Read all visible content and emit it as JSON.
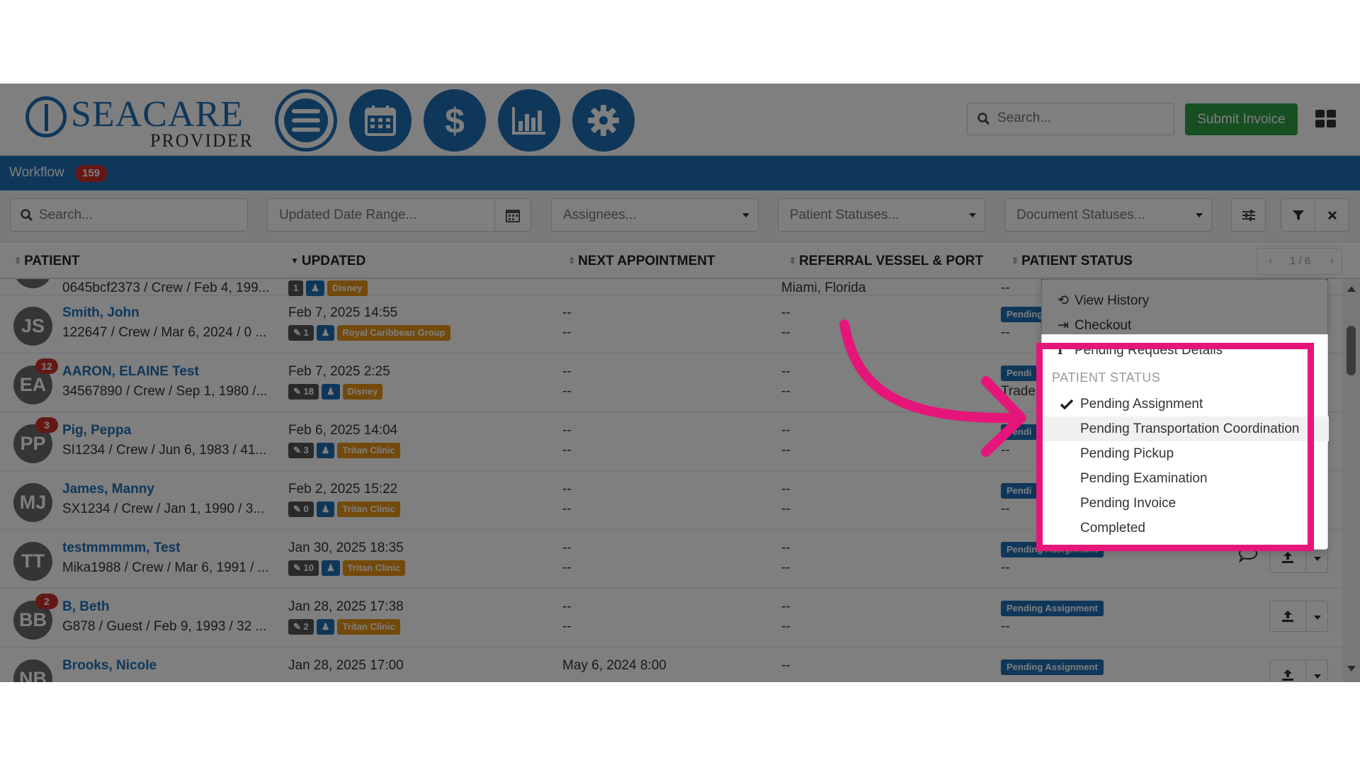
{
  "brand": {
    "name": "SEACARE",
    "sub": "PROVIDER"
  },
  "top": {
    "search_placeholder": "Search...",
    "submit_label": "Submit Invoice"
  },
  "workflow": {
    "title": "Workflow",
    "count": "159"
  },
  "filters": {
    "search_placeholder": "Search...",
    "date_placeholder": "Updated Date Range...",
    "assignees": "Assignees...",
    "patient_statuses": "Patient Statuses...",
    "document_statuses": "Document Statuses..."
  },
  "columns": {
    "patient": "PATIENT",
    "updated": "UPDATED",
    "next_appt": "NEXT APPOINTMENT",
    "referral": "REFERRAL VESSEL & PORT",
    "status": "PATIENT STATUS"
  },
  "pager": {
    "prev": "‹",
    "text": "1 / 6",
    "next": "›"
  },
  "partial_row": {
    "info": "0645bcf2373 / Crew / Feb 4, 199...",
    "port": "Miami, Florida",
    "tag1": "1",
    "tag2": "Disney",
    "status": "--"
  },
  "rows": [
    {
      "initials": "JS",
      "badge": "",
      "name": "Smith, John",
      "info": "122647 / Crew / Mar 6, 2024 / 0 ...",
      "updated": "Feb 7, 2025 14:55",
      "count": "1",
      "clinic": "Royal Caribbean Group",
      "appt1": "--",
      "appt2": "--",
      "ref1": "--",
      "ref2": "--",
      "status": "Pending",
      "status2": "--"
    },
    {
      "initials": "EA",
      "badge": "12",
      "name": "AARON, ELAINE Test",
      "info": "34567890 / Crew / Sep 1, 1980 /...",
      "updated": "Feb 7, 2025 2:25",
      "count": "18",
      "clinic": "Disney",
      "appt1": "--",
      "appt2": "--",
      "ref1": "--",
      "ref2": "--",
      "status": "Pendi",
      "status2": "Trader"
    },
    {
      "initials": "PP",
      "badge": "3",
      "name": "Pig, Peppa",
      "info": "SI1234 / Crew / Jun 6, 1983 / 41...",
      "updated": "Feb 6, 2025 14:04",
      "count": "3",
      "clinic": "Tritan Clinic",
      "appt1": "--",
      "appt2": "--",
      "ref1": "--",
      "ref2": "--",
      "status": "Pendi",
      "status2": "--"
    },
    {
      "initials": "MJ",
      "badge": "",
      "name": "James, Manny",
      "info": "SX1234 / Crew / Jan 1, 1990 / 3...",
      "updated": "Feb 2, 2025 15:22",
      "count": "0",
      "clinic": "Tritan Clinic",
      "appt1": "--",
      "appt2": "--",
      "ref1": "--",
      "ref2": "--",
      "status": "Pendi",
      "status2": "--"
    },
    {
      "initials": "TT",
      "badge": "",
      "name": "testmmmmm, Test",
      "info": "Mika1988 / Crew / Mar 6, 1991 / ...",
      "updated": "Jan 30, 2025 18:35",
      "count": "10",
      "clinic": "Tritan Clinic",
      "appt1": "--",
      "appt2": "--",
      "ref1": "--",
      "ref2": "--",
      "status": "Pending Assignment",
      "status2": "--"
    },
    {
      "initials": "BB",
      "badge": "2",
      "name": "B, Beth",
      "info": "G878 / Guest / Feb 9, 1993 / 32 ...",
      "updated": "Jan 28, 2025 17:38",
      "count": "2",
      "clinic": "Tritan Clinic",
      "appt1": "--",
      "appt2": "--",
      "ref1": "--",
      "ref2": "--",
      "status": "Pending Assignment",
      "status2": "--"
    },
    {
      "initials": "NB",
      "badge": "",
      "name": "Brooks, Nicole",
      "info": "",
      "updated": "Jan 28, 2025 17:00",
      "count": "",
      "clinic": "",
      "appt1": "May 6, 2024 8:00",
      "appt2": "",
      "ref1": "--",
      "ref2": "",
      "status": "Pending Assignment",
      "status2": ""
    }
  ],
  "menu": {
    "actions": [
      "View History",
      "Checkout",
      "Pending Request Details"
    ],
    "section": "PATIENT STATUS",
    "options": [
      "Pending Assignment",
      "Pending Transportation Coordination",
      "Pending Pickup",
      "Pending Examination",
      "Pending Invoice",
      "Completed"
    ],
    "selected_index": 0,
    "hovered_index": 1
  },
  "colors": {
    "brand_blue": "#1f6fb5",
    "submit_green": "#2e9e44",
    "badge_red": "#c9302c",
    "highlight_pink": "#e6157a",
    "clinic_orange": "#e69419"
  }
}
